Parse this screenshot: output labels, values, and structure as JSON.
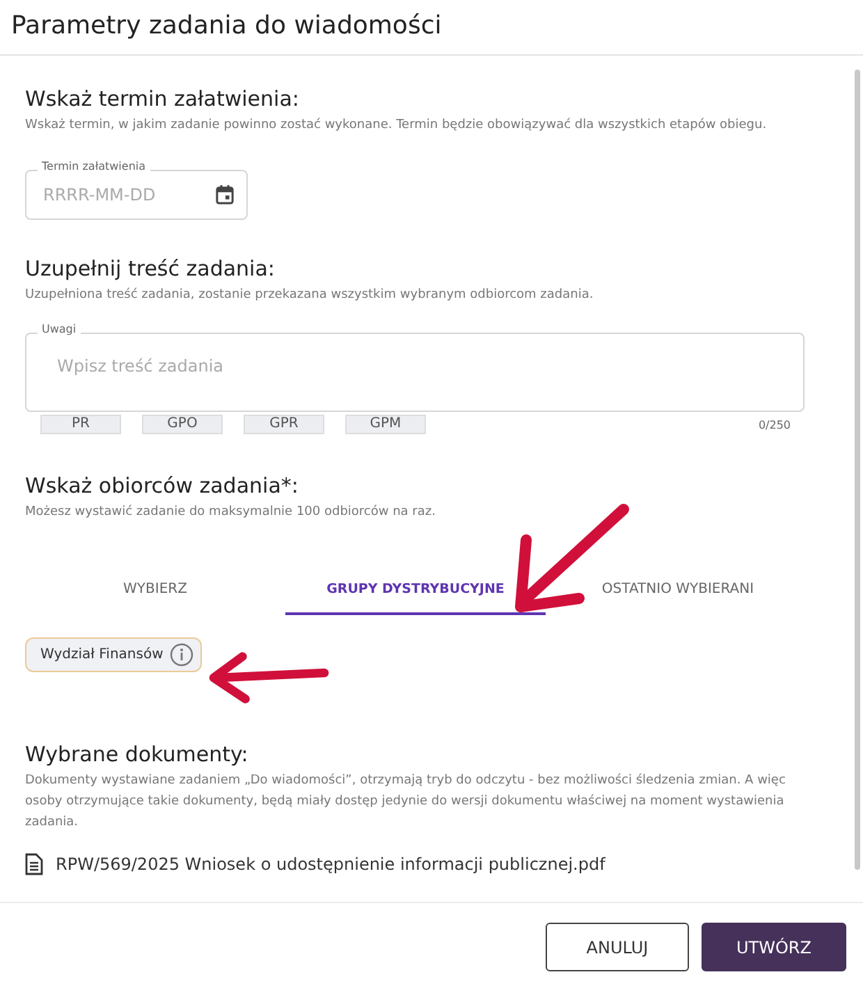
{
  "dialog": {
    "title": "Parametry zadania do wiadomości"
  },
  "deadline": {
    "heading": "Wskaż termin załatwienia:",
    "description": "Wskaż termin, w jakim zadanie powinno zostać wykonane. Termin będzie obowiązywać dla wszystkich etapów obiegu.",
    "field": {
      "label": "Termin załatwienia",
      "placeholder": "RRRR-MM-DD"
    }
  },
  "content": {
    "heading": "Uzupełnij treść zadania:",
    "description": "Uzupełniona treść zadania, zostanie przekazana wszystkim wybranym odbiorcom zadania.",
    "field": {
      "label": "Uwagi",
      "placeholder": "Wpisz treść zadania"
    },
    "shortcuts": [
      "PR",
      "GPO",
      "GPR",
      "GPM"
    ],
    "counter": "0/250"
  },
  "recipients": {
    "heading": "Wskaż obiorców zadania*:",
    "description": "Możesz wystawić zadanie do maksymalnie 100 odbiorców na raz.",
    "tabs": [
      {
        "label": "WYBIERZ",
        "selected": false
      },
      {
        "label": "GRUPY DYSTRYBUCYJNE",
        "selected": true
      },
      {
        "label": "OSTATNIO WYBIERANI",
        "selected": false
      }
    ],
    "groups": [
      {
        "label": "Wydział Finansów"
      }
    ]
  },
  "documents": {
    "heading": "Wybrane dokumenty:",
    "description": "Dokumenty wystawiane zadaniem „Do wiadomości”, otrzymają tryb do odczytu - bez możliwości śledzenia zmian. A więc osoby otrzymujące takie dokumenty, będą miały dostęp jedynie do wersji dokumentu właściwej na moment wystawienia zadania.",
    "files": [
      "RPW/569/2025 Wniosek o udostępnienie informacji publicznej.pdf"
    ]
  },
  "buttons": [
    {
      "label": "ANULUJ",
      "kind": "secondary"
    },
    {
      "label": "UTWÓRZ",
      "kind": "primary"
    }
  ]
}
